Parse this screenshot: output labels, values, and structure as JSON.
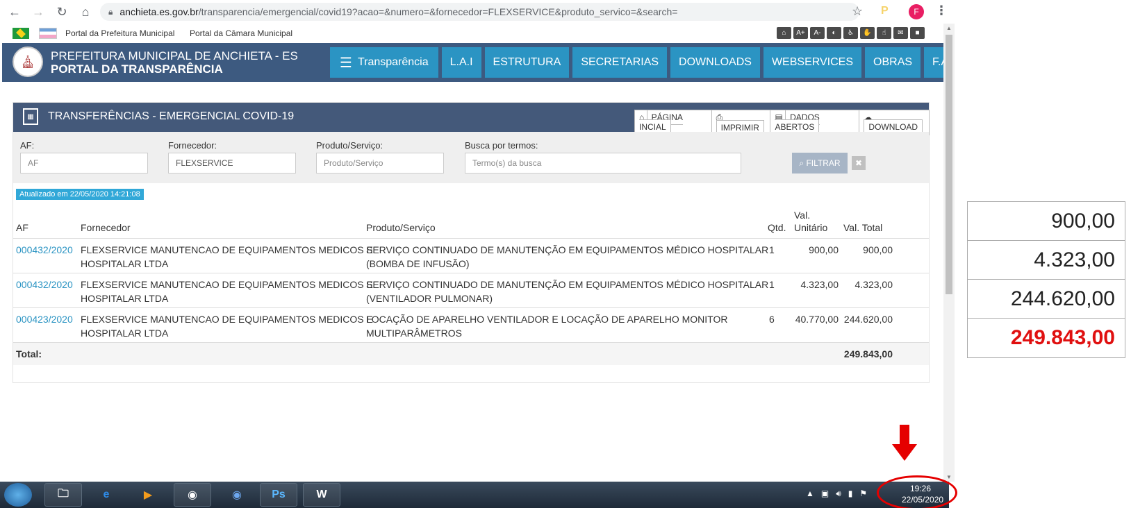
{
  "browser": {
    "url_host": "anchieta.es.gov.br",
    "url_path": "/transparencia/emergencial/covid19?acao=&numero=&fornecedor=FLEXSERVICE&produto_servico=&search=",
    "avatar_letter": "F"
  },
  "top_links": [
    "Portal da Prefeitura Municipal",
    "Portal da Câmara Municipal"
  ],
  "header": {
    "line1": "PREFEITURA MUNICIPAL DE ANCHIETA - ES",
    "line2": "PORTAL DA TRANSPARÊNCIA",
    "menu": [
      "Transparência",
      "L.A.I",
      "ESTRUTURA",
      "SECRETARIAS",
      "DOWNLOADS",
      "WEBSERVICES",
      "OBRAS",
      "F.A.Q."
    ]
  },
  "panel": {
    "title": "TRANSFERÊNCIAS - EMERGENCIAL COVID-19",
    "actions": [
      "PÁGINA INCIAL",
      "IMPRIMIR",
      "DADOS ABERTOS",
      "DOWNLOAD"
    ]
  },
  "filters": {
    "af_label": "AF:",
    "af_placeholder": "AF",
    "fornecedor_label": "Fornecedor:",
    "fornecedor_value": "FLEXSERVICE",
    "produto_label": "Produto/Serviço:",
    "produto_placeholder": "Produto/Serviço",
    "busca_label": "Busca por termos:",
    "busca_placeholder": "Termo(s) da busca",
    "filter_button": "FILTRAR"
  },
  "updated_badge": "Atualizado em 22/05/2020 14:21:08",
  "table": {
    "headers": {
      "af": "AF",
      "fornecedor": "Fornecedor",
      "produto": "Produto/Serviço",
      "qtd": "Qtd.",
      "val_unit_1": "Val.",
      "val_unit_2": "Unitário",
      "val_total": "Val. Total"
    },
    "rows": [
      {
        "af": "000432/2020",
        "forn1": "FLEXSERVICE MANUTENCAO DE EQUIPAMENTOS MEDICOS E",
        "forn2": "HOSPITALAR LTDA",
        "prod1": "SERVIÇO CONTINUADO DE MANUTENÇÃO EM EQUIPAMENTOS MÉDICO HOSPITALAR",
        "prod2": "(BOMBA DE INFUSÃO)",
        "qtd": "1",
        "unit": "900,00",
        "total": "900,00"
      },
      {
        "af": "000432/2020",
        "forn1": "FLEXSERVICE MANUTENCAO DE EQUIPAMENTOS MEDICOS E",
        "forn2": "HOSPITALAR LTDA",
        "prod1": "SERVIÇO CONTINUADO DE MANUTENÇÃO EM EQUIPAMENTOS MÉDICO HOSPITALAR",
        "prod2": "(VENTILADOR PULMONAR)",
        "qtd": "1",
        "unit": "4.323,00",
        "total": "4.323,00"
      },
      {
        "af": "000423/2020",
        "forn1": "FLEXSERVICE MANUTENCAO DE EQUIPAMENTOS MEDICOS E",
        "forn2": "HOSPITALAR LTDA",
        "prod1": "LOCAÇÃO DE APARELHO VENTILADOR E LOCAÇÃO DE APARELHO MONITOR",
        "prod2": "MULTIPARÂMETROS",
        "qtd": "6",
        "unit": "40.770,00",
        "total": "244.620,00"
      }
    ],
    "total_label": "Total:",
    "total_value": "249.843,00"
  },
  "taskbar": {
    "time": "19:26",
    "date": "22/05/2020"
  },
  "zoom_values": [
    "900,00",
    "4.323,00",
    "244.620,00",
    "249.843,00"
  ]
}
